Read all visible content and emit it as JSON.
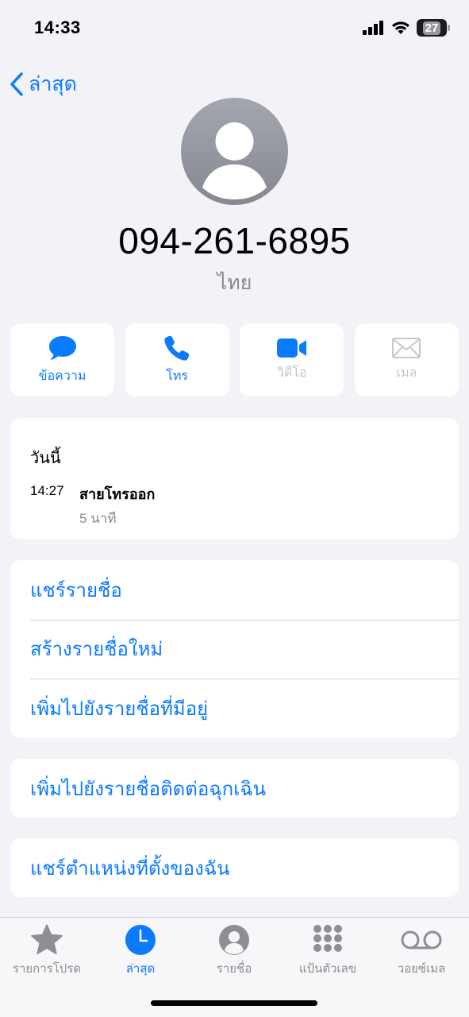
{
  "status": {
    "time": "14:33",
    "battery": "27"
  },
  "nav": {
    "back_label": "ล่าสุด"
  },
  "contact": {
    "number": "094-261-6895",
    "country": "ไทย"
  },
  "actions": [
    {
      "label": "ข้อความ",
      "icon": "message-icon",
      "enabled": true
    },
    {
      "label": "โทร",
      "icon": "phone-icon",
      "enabled": true
    },
    {
      "label": "วิดีโอ",
      "icon": "video-icon",
      "enabled": false
    },
    {
      "label": "เมล",
      "icon": "mail-icon",
      "enabled": false
    }
  ],
  "recents": {
    "heading": "วันนี้",
    "entries": [
      {
        "time": "14:27",
        "type": "สายโทรออก",
        "duration": "5 นาที"
      }
    ]
  },
  "options": {
    "group1": [
      "แชร์รายชื่อ",
      "สร้างรายชื่อใหม่",
      "เพิ่มไปยังรายชื่อที่มีอยู่"
    ],
    "group2": [
      "เพิ่มไปยังรายชื่อติดต่อฉุกเฉิน"
    ],
    "group3": [
      "แชร์ตำแหน่งที่ตั้งของฉัน"
    ]
  },
  "tabs": [
    {
      "label": "รายการโปรด",
      "icon": "star-icon",
      "active": false
    },
    {
      "label": "ล่าสุด",
      "icon": "clock-icon",
      "active": true
    },
    {
      "label": "รายชื่อ",
      "icon": "person-circle-icon",
      "active": false
    },
    {
      "label": "แป้นตัวเลข",
      "icon": "keypad-icon",
      "active": false
    },
    {
      "label": "วอยซ์เมล",
      "icon": "voicemail-icon",
      "active": false
    }
  ],
  "colors": {
    "accent": "#0a7aff",
    "disabled": "#c7c7cc",
    "background": "#f2f2f7",
    "inactive_tab": "#8e8e93"
  }
}
